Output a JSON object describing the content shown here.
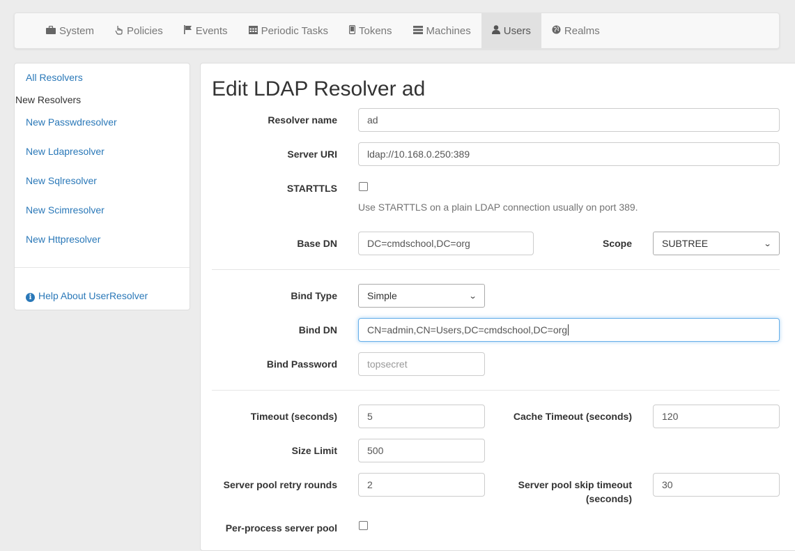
{
  "nav": {
    "items": [
      {
        "label": "System",
        "icon": "briefcase-icon"
      },
      {
        "label": "Policies",
        "icon": "hand-pointer-icon"
      },
      {
        "label": "Events",
        "icon": "flag-icon"
      },
      {
        "label": "Periodic Tasks",
        "icon": "calendar-icon"
      },
      {
        "label": "Tokens",
        "icon": "phone-icon"
      },
      {
        "label": "Machines",
        "icon": "tasks-icon"
      },
      {
        "label": "Users",
        "icon": "user-icon"
      },
      {
        "label": "Realms",
        "icon": "globe-icon"
      }
    ],
    "active": "Users"
  },
  "sidebar": {
    "all_resolvers": "All Resolvers",
    "new_heading": "New Resolvers",
    "links": [
      "New Passwdresolver",
      "New Ldapresolver",
      "New Sqlresolver",
      "New Scimresolver",
      "New Httpresolver"
    ],
    "help": "Help About UserResolver"
  },
  "form": {
    "title": "Edit LDAP Resolver ad",
    "resolver_name": {
      "label": "Resolver name",
      "value": "ad"
    },
    "server_uri": {
      "label": "Server URI",
      "value": "ldap://10.168.0.250:389"
    },
    "starttls": {
      "label": "STARTTLS",
      "checked": false,
      "help": "Use STARTTLS on a plain LDAP connection usually on port 389."
    },
    "base_dn": {
      "label": "Base DN",
      "value": "DC=cmdschool,DC=org"
    },
    "scope": {
      "label": "Scope",
      "value": "SUBTREE"
    },
    "bind_type": {
      "label": "Bind Type",
      "value": "Simple"
    },
    "bind_dn": {
      "label": "Bind DN",
      "value": "CN=admin,CN=Users,DC=cmdschool,DC=org"
    },
    "bind_password": {
      "label": "Bind Password",
      "placeholder": "topsecret"
    },
    "timeout": {
      "label": "Timeout (seconds)",
      "value": "5"
    },
    "cache_timeout": {
      "label": "Cache Timeout (seconds)",
      "value": "120"
    },
    "size_limit": {
      "label": "Size Limit",
      "value": "500"
    },
    "retry_rounds": {
      "label": "Server pool retry rounds",
      "value": "2"
    },
    "skip_timeout": {
      "label_line1": "Server pool skip timeout",
      "label_line2": "(seconds)",
      "value": "30"
    },
    "per_process": {
      "label": "Per-process server pool",
      "checked": false
    }
  },
  "colors": {
    "link": "#2a78b8",
    "focus": "#66afe9",
    "nav_active": "#e1e1e1"
  }
}
